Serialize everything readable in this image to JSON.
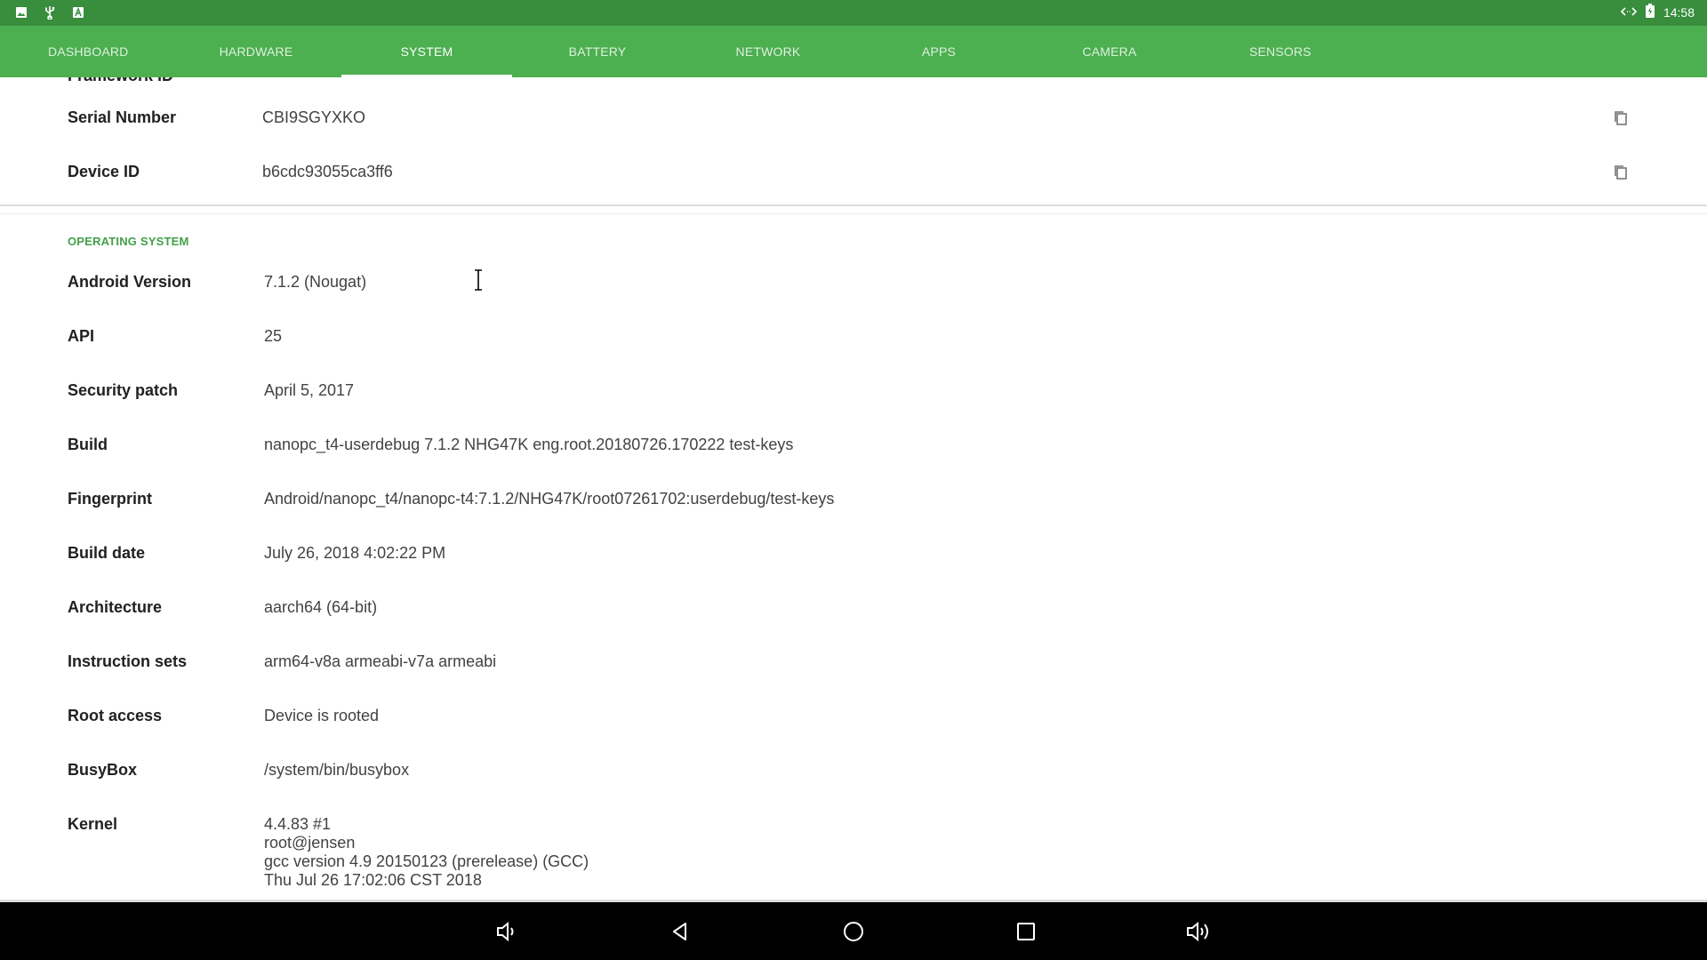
{
  "status_bar": {
    "left_icons": [
      "image-icon",
      "usb-icon",
      "font-icon"
    ],
    "right_icons": [
      "code-icon",
      "battery-charging-icon"
    ],
    "time": "14:58"
  },
  "tabs": [
    {
      "label": "DASHBOARD",
      "active": false
    },
    {
      "label": "HARDWARE",
      "active": false
    },
    {
      "label": "SYSTEM",
      "active": true
    },
    {
      "label": "BATTERY",
      "active": false
    },
    {
      "label": "NETWORK",
      "active": false
    },
    {
      "label": "APPS",
      "active": false
    },
    {
      "label": "CAMERA",
      "active": false
    },
    {
      "label": "SENSORS",
      "active": false
    }
  ],
  "hardware_rows": [
    {
      "label": "Framework ID",
      "value": ""
    },
    {
      "label": "Serial Number",
      "value": "CBI9SGYXKO"
    },
    {
      "label": "Device ID",
      "value": "b6cdc93055ca3ff6"
    }
  ],
  "os_section": {
    "title": "OPERATING SYSTEM",
    "rows": [
      {
        "label": "Android Version",
        "value": "7.1.2 (Nougat)"
      },
      {
        "label": "API",
        "value": "25"
      },
      {
        "label": "Security patch",
        "value": "April 5, 2017"
      },
      {
        "label": "Build",
        "value": "nanopc_t4-userdebug 7.1.2 NHG47K eng.root.20180726.170222 test-keys"
      },
      {
        "label": "Fingerprint",
        "value": "Android/nanopc_t4/nanopc-t4:7.1.2/NHG47K/root07261702:userdebug/test-keys"
      },
      {
        "label": "Build date",
        "value": "July 26, 2018 4:02:22 PM"
      },
      {
        "label": "Architecture",
        "value": "aarch64 (64-bit)"
      },
      {
        "label": "Instruction sets",
        "value": "arm64-v8a armeabi-v7a armeabi"
      },
      {
        "label": "Root access",
        "value": "Device is rooted"
      },
      {
        "label": "BusyBox",
        "value": "/system/bin/busybox"
      }
    ],
    "kernel": {
      "label": "Kernel",
      "lines": [
        "4.4.83 #1",
        "root@jensen",
        "gcc version 4.9 20150123 (prerelease) (GCC)",
        "Thu Jul 26 17:02:06 CST 2018"
      ]
    }
  },
  "nav_bar": [
    "volume-down-icon",
    "back-icon",
    "home-icon",
    "recents-icon",
    "volume-up-icon"
  ],
  "colors": {
    "accent": "#4caf50",
    "status_bar": "#388e3c",
    "section_title": "#43a047"
  }
}
